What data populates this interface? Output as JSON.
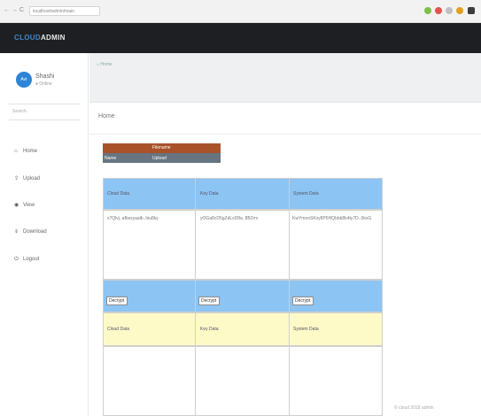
{
  "browser": {
    "back": "←",
    "forward": "→",
    "reload": "C",
    "url": "localhost/admin/main",
    "extensions": [
      "#7fbf4a",
      "#e2544a",
      "#c0c0c0",
      "#e0a020",
      "#3c3c3c"
    ]
  },
  "header": {
    "brand_part1": "CLOUD",
    "brand_part2": "ADMIN"
  },
  "sidebar": {
    "avatar_text": "Avt",
    "user_name": "Shashi",
    "user_status": "● Online",
    "search_placeholder": "Search",
    "items": [
      {
        "icon": "home-icon",
        "glyph": "⌂",
        "label": "Home"
      },
      {
        "icon": "upload-icon",
        "glyph": "⇪",
        "label": "Upload"
      },
      {
        "icon": "view-icon",
        "glyph": "◉",
        "label": "View"
      },
      {
        "icon": "download-icon",
        "glyph": "⇓",
        "label": "Download"
      },
      {
        "icon": "logout-icon",
        "glyph": "⏻",
        "label": "Logout"
      }
    ]
  },
  "breadcrumb": {
    "home_icon": "home-icon",
    "label": "Home"
  },
  "page": {
    "title": "Home"
  },
  "mini_table": {
    "header": "Filename",
    "row_col1": "Name",
    "row_col2": "Upload"
  },
  "grid": {
    "top_headers": [
      "Cloud Data",
      "Key Data",
      "System Data"
    ],
    "top_values": [
      "x7Qlvj..afbxxyaalb..hiu8ky",
      "yOGa8cD5gZdLsD8a..8B2rrv",
      "KwYmnoSKvy8P5HQbbb8k4ty7D..0kxG"
    ],
    "inputs": [
      "Decrypt",
      "Decrypt",
      "Decrypt"
    ],
    "bottom_headers": [
      "Cloud Data",
      "Key Data",
      "System Data"
    ]
  },
  "footer": "© cloud 2018 admin"
}
